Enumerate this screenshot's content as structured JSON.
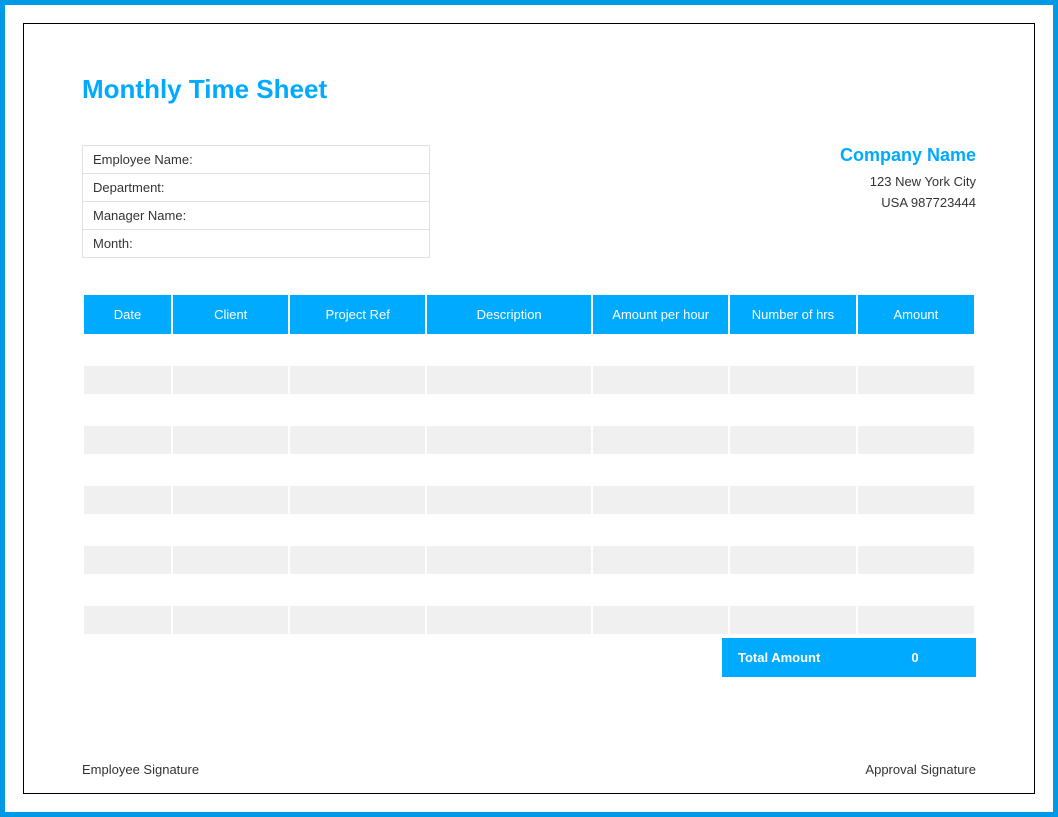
{
  "title": "Monthly Time Sheet",
  "info": {
    "employee_name_label": "Employee Name:",
    "department_label": "Department:",
    "manager_name_label": "Manager Name:",
    "month_label": "Month:"
  },
  "company": {
    "name": "Company Name",
    "address_line1": "123 New York City",
    "address_line2": "USA 987723444"
  },
  "table": {
    "headers": {
      "date": "Date",
      "client": "Client",
      "project_ref": "Project Ref",
      "description": "Description",
      "amount_per_hour": "Amount per hour",
      "number_of_hrs": "Number of hrs",
      "amount": "Amount"
    },
    "rows": [
      {
        "date": "",
        "client": "",
        "project_ref": "",
        "description": "",
        "amount_per_hour": "",
        "number_of_hrs": "",
        "amount": ""
      },
      {
        "date": "",
        "client": "",
        "project_ref": "",
        "description": "",
        "amount_per_hour": "",
        "number_of_hrs": "",
        "amount": ""
      },
      {
        "date": "",
        "client": "",
        "project_ref": "",
        "description": "",
        "amount_per_hour": "",
        "number_of_hrs": "",
        "amount": ""
      },
      {
        "date": "",
        "client": "",
        "project_ref": "",
        "description": "",
        "amount_per_hour": "",
        "number_of_hrs": "",
        "amount": ""
      },
      {
        "date": "",
        "client": "",
        "project_ref": "",
        "description": "",
        "amount_per_hour": "",
        "number_of_hrs": "",
        "amount": ""
      },
      {
        "date": "",
        "client": "",
        "project_ref": "",
        "description": "",
        "amount_per_hour": "",
        "number_of_hrs": "",
        "amount": ""
      },
      {
        "date": "",
        "client": "",
        "project_ref": "",
        "description": "",
        "amount_per_hour": "",
        "number_of_hrs": "",
        "amount": ""
      },
      {
        "date": "",
        "client": "",
        "project_ref": "",
        "description": "",
        "amount_per_hour": "",
        "number_of_hrs": "",
        "amount": ""
      },
      {
        "date": "",
        "client": "",
        "project_ref": "",
        "description": "",
        "amount_per_hour": "",
        "number_of_hrs": "",
        "amount": ""
      },
      {
        "date": "",
        "client": "",
        "project_ref": "",
        "description": "",
        "amount_per_hour": "",
        "number_of_hrs": "",
        "amount": ""
      }
    ]
  },
  "total": {
    "label": "Total Amount",
    "value": "0"
  },
  "signatures": {
    "employee": "Employee Signature",
    "approval": "Approval Signature"
  }
}
